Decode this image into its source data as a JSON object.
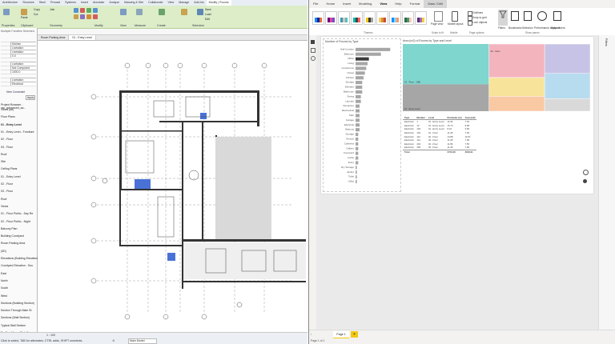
{
  "cad": {
    "tabs": [
      "Architecture",
      "Structure",
      "Steel",
      "Precast",
      "Systems",
      "Insert",
      "Annotate",
      "Analyze",
      "Massing & Site",
      "Collaborate",
      "View",
      "Manage",
      "Add-Ins",
      "Modify | Rooms"
    ],
    "active_tab": "Modify | Rooms",
    "ribbon_groups": [
      "Properties",
      "Clipboard",
      "Geometry",
      "Modify",
      "View",
      "Measure",
      "Create",
      "Selection"
    ],
    "ribbon_buttons": {
      "copy": "Copy",
      "cut": "Cut",
      "join": "Join",
      "paste": "Paste",
      "modify": "Modify",
      "save": "Save",
      "load": "Load",
      "edit": "Edit"
    },
    "options_bar": "Rooms",
    "properties": {
      "type": "Multiple Families Selected",
      "rows": [
        {
          "label": "",
          "value": ""
        },
        {
          "label": "",
          "value": "Kitchen"
        },
        {
          "label": "",
          "value": "Livelation"
        },
        {
          "label": "",
          "value": "Livelation"
        },
        {
          "label": "",
          "value": "0.0"
        },
        {
          "label": "",
          "value": ""
        },
        {
          "label": "",
          "value": "Livelation"
        },
        {
          "label": "",
          "value": "Not Computed"
        },
        {
          "label": "",
          "value": "1000.0"
        },
        {
          "label": "",
          "value": ""
        },
        {
          "label": "",
          "value": "Livelation"
        },
        {
          "label": "",
          "value": "Electrical"
        }
      ],
      "new_constraint": "New Constraint",
      "apply": "Apply"
    },
    "project_browser": {
      "title": "Project Browser - rac_advanced_sa...",
      "items": [
        "Views (all)",
        "Floor Plans",
        "01 - Entry Level",
        "01 - Entry Level - Furniture",
        "02 - Floor",
        "03 - Floor",
        "Roof",
        "Site",
        "Ceiling Plans",
        "01 - Entry Level",
        "02 - Floor",
        "03 - Floor",
        "Roof",
        "Views",
        "01 - Floor Public - Day Re",
        "02 - Floor Public - Night",
        "Balcony Plan",
        "Building Courtyard",
        "Room Parking Area",
        "(3D)",
        "Elevations (Building Elevation",
        "Courtyard Elevation - Sou",
        "East",
        "North",
        "South",
        "West",
        "Sections (Building Section)",
        "Section Through Main St",
        "Sections (Wall Section)",
        "Typical Wall Section",
        "Drafting Views (Detail)"
      ]
    },
    "view_tabs": [
      "Room Parking Area",
      "01 - Entry Level"
    ],
    "active_view": "01 - Entry Level",
    "status": {
      "scale": "1 : 100",
      "hint": "Click to select, TAB for alternates, CTRL adds, SHIFT unselects.",
      "model": "Main Model",
      "zero": ":0"
    },
    "grid_labels": [
      "1",
      "2",
      "3",
      "4",
      "5",
      "6",
      "7",
      "8",
      "9",
      "A",
      "B",
      "C",
      "D",
      "E",
      "F",
      "G",
      "H",
      "J",
      "K",
      "L",
      "M",
      "N",
      "P"
    ]
  },
  "pbi": {
    "tabs": [
      "File",
      "Home",
      "Insert",
      "Modeling",
      "View",
      "Help",
      "Format",
      "Data / Drill"
    ],
    "active_tab": "View",
    "context_tab": "Data / Drill",
    "ribbon": {
      "themes_label": "Themes",
      "scale_to_fit": "Scale to fit",
      "page_view": "Page view",
      "mobile_layout": "Mobile layout",
      "mobile_label": "Mobile",
      "gridlines": "Gridlines",
      "snap_to_grid": "Snap to grid",
      "lock_objects": "Lock objects",
      "page_options": "Page options",
      "filters": "Filters",
      "bookmarks": "Bookmarks",
      "selection": "Selection",
      "performance": "Performance analyzer",
      "sync_slicers": "Sync slicers",
      "show_panes": "Show panes"
    },
    "right_pane_label": "Filters",
    "page_tab": "Page 1",
    "add_page": "+",
    "status": "Page 1 of 1",
    "colors": {
      "accent": "#f2c811",
      "bar": "#a6a6a6",
      "bar_selected": "#3a3a3a",
      "teal": "#7fd6cf",
      "pink": "#f4b4be"
    }
  },
  "chart_data": [
    {
      "type": "bar",
      "title": "Number of Rooms by Type",
      "categories": [
        "Hall Corridor",
        "Bedroom",
        "Office",
        "Living",
        "Conference",
        "Closet",
        "Kitchen",
        "Storage",
        "Elevator",
        "Bathroom",
        "Dining",
        "Laundry",
        "Reception",
        "Mechanical",
        "Stair",
        "Garage",
        "Electrical",
        "Balcony",
        "Storage",
        "Terrace",
        "Cafeteria",
        "Gallery",
        "Courtyard",
        "Lobby",
        "Entry",
        "Dry Storage",
        "Janitor",
        "Toilet",
        "Utility"
      ],
      "values": [
        26,
        19,
        10,
        9,
        8,
        7,
        6,
        5,
        5,
        5,
        4,
        4,
        3,
        3,
        3,
        3,
        3,
        3,
        2,
        2,
        2,
        2,
        2,
        2,
        2,
        1,
        1,
        1,
        1
      ],
      "selected_category": "Office",
      "xlim": [
        0,
        30
      ]
    },
    {
      "type": "heatmap",
      "title": "Area (m2) of Rooms by Type and Level",
      "blocks": [
        {
          "label": "01 - Floor - 1/Bil",
          "value": 40,
          "color": "#7fd6cf"
        },
        {
          "label": "02 - Floor",
          "value": 18,
          "color": "#f4b4be"
        },
        {
          "label": "",
          "value": 14,
          "color": "#c7c3e6"
        },
        {
          "label": "",
          "value": 12,
          "color": "#b8dcef"
        },
        {
          "label": "01 - Entry Level",
          "value": 22,
          "color": "#a6a6a6"
        },
        {
          "label": "",
          "value": 10,
          "color": "#f7e49a"
        },
        {
          "label": "",
          "value": 8,
          "color": "#f9c9a3"
        },
        {
          "label": "",
          "value": 6,
          "color": "#d9d9d9"
        }
      ]
    },
    {
      "type": "table",
      "columns": [
        "Type",
        "Number",
        "Level",
        "Perimeter (m)",
        "Area (m2)"
      ],
      "rows": [
        [
          "Electrical",
          "1",
          "01 - Entry Level",
          "11.66",
          "7.64"
        ],
        [
          "Electrical",
          "10",
          "01 - Entry Level",
          "15.74",
          "9.68"
        ],
        [
          "Electrical",
          "103",
          "01 - Entry Level",
          "8.24",
          "3.96"
        ],
        [
          "Electrical",
          "104",
          "01 - Floor",
          "11.28",
          "7.06"
        ],
        [
          "Electrical",
          "112",
          "02 - Floor",
          "13.88",
          "10.97"
        ],
        [
          "Electrical",
          "114",
          "03 - Floor",
          "11.28",
          "7.06"
        ],
        [
          "Electrical",
          "203",
          "02 - Floor",
          "11.89",
          "7.55"
        ],
        [
          "Electrical",
          "305",
          "03 - Floor",
          "11.28",
          "7.06"
        ]
      ],
      "total": [
        "Total",
        "",
        "",
        "2743.39",
        "3016.91"
      ]
    }
  ]
}
